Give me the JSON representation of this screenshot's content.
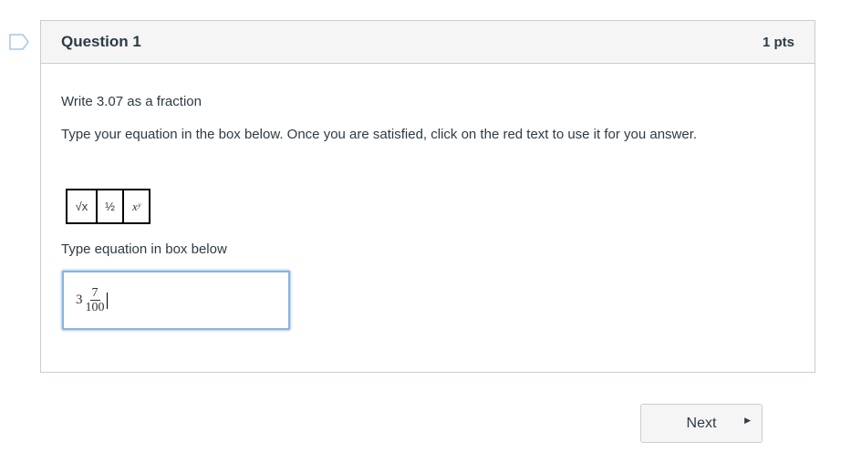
{
  "question": {
    "title": "Question 1",
    "points": "1 pts",
    "prompt": "Write 3.07 as a fraction",
    "instructions": "Type your equation in the box below.  Once you are satisfied, click on the red text to use it for you answer.",
    "toolbar": [
      "√x",
      "½",
      "xʸ"
    ],
    "input_label": "Type equation in box below",
    "answer": {
      "whole": "3",
      "numerator": "7",
      "denominator": "100"
    }
  },
  "nav": {
    "next_label": "Next"
  }
}
